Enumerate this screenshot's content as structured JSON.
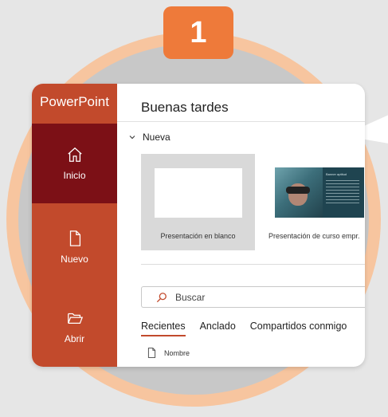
{
  "step": {
    "number": "1"
  },
  "app": {
    "name": "PowerPoint"
  },
  "sidebar": {
    "items": [
      {
        "label": "Inicio",
        "icon": "home-icon",
        "active": true
      },
      {
        "label": "Nuevo",
        "icon": "new-document-icon",
        "active": false
      },
      {
        "label": "Abrir",
        "icon": "folder-open-icon",
        "active": false
      }
    ]
  },
  "main": {
    "greeting": "Buenas tardes",
    "new_section": {
      "label": "Nueva",
      "icon": "chevron-down-icon"
    },
    "templates": [
      {
        "caption": "Presentación en blanco"
      },
      {
        "caption": "Presentación de curso empr.",
        "thumb_title": "Banner aptitud"
      }
    ],
    "search": {
      "placeholder": "Buscar",
      "icon": "search-icon"
    },
    "tabs": [
      {
        "label": "Recientes",
        "active": true
      },
      {
        "label": "Anclado",
        "active": false
      },
      {
        "label": "Compartidos conmigo",
        "active": false
      }
    ],
    "list": {
      "column_name": "Nombre",
      "icon": "file-icon"
    }
  },
  "colors": {
    "sidebar": "#c24a2c",
    "sidebar_active": "#7c1016",
    "badge": "#ee7a3a",
    "ring_outer": "#f7c59f",
    "ring_inner": "#c8c8c8"
  }
}
